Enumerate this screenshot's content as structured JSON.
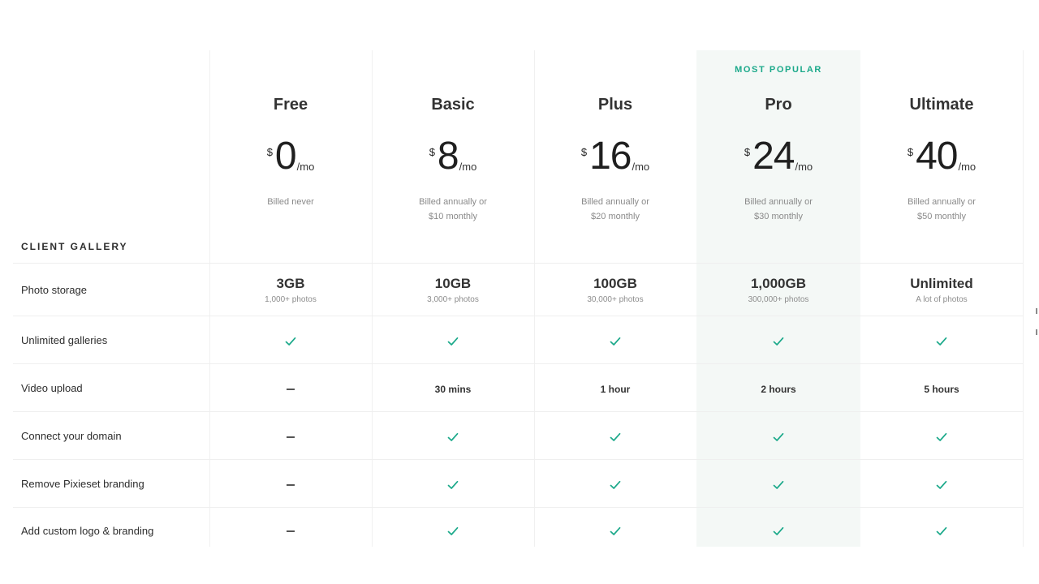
{
  "badge": "MOST POPULAR",
  "section_title": "CLIENT GALLERY",
  "currency_symbol": "$",
  "per_label": "/mo",
  "plans": [
    {
      "name": "Free",
      "price": "0",
      "billing1": "Billed never",
      "billing2": ""
    },
    {
      "name": "Basic",
      "price": "8",
      "billing1": "Billed annually or",
      "billing2": "$10 monthly"
    },
    {
      "name": "Plus",
      "price": "16",
      "billing1": "Billed annually or",
      "billing2": "$20 monthly"
    },
    {
      "name": "Pro",
      "price": "24",
      "billing1": "Billed annually or",
      "billing2": "$30 monthly"
    },
    {
      "name": "Ultimate",
      "price": "40",
      "billing1": "Billed annually or",
      "billing2": "$50 monthly"
    }
  ],
  "features": [
    {
      "label": "Photo storage",
      "type": "storage",
      "values": [
        {
          "main": "3GB",
          "sub": "1,000+ photos"
        },
        {
          "main": "10GB",
          "sub": "3,000+ photos"
        },
        {
          "main": "100GB",
          "sub": "30,000+ photos"
        },
        {
          "main": "1,000GB",
          "sub": "300,000+ photos"
        },
        {
          "main": "Unlimited",
          "sub": "A lot of photos"
        }
      ]
    },
    {
      "label": "Unlimited galleries",
      "type": "flags",
      "values": [
        "check",
        "check",
        "check",
        "check",
        "check"
      ]
    },
    {
      "label": "Video upload",
      "type": "mixed",
      "values": [
        "dash",
        "30 mins",
        "1 hour",
        "2 hours",
        "5 hours"
      ]
    },
    {
      "label": "Connect your domain",
      "type": "flags",
      "values": [
        "dash",
        "check",
        "check",
        "check",
        "check"
      ]
    },
    {
      "label": "Remove Pixieset branding",
      "type": "flags",
      "values": [
        "dash",
        "check",
        "check",
        "check",
        "check"
      ]
    },
    {
      "label": "Add custom logo & branding",
      "type": "flags",
      "values": [
        "dash",
        "check",
        "check",
        "check",
        "check"
      ]
    }
  ],
  "colors": {
    "accent": "#1ba98a",
    "highlight_bg": "#f4f8f6",
    "divider": "#efefef"
  }
}
